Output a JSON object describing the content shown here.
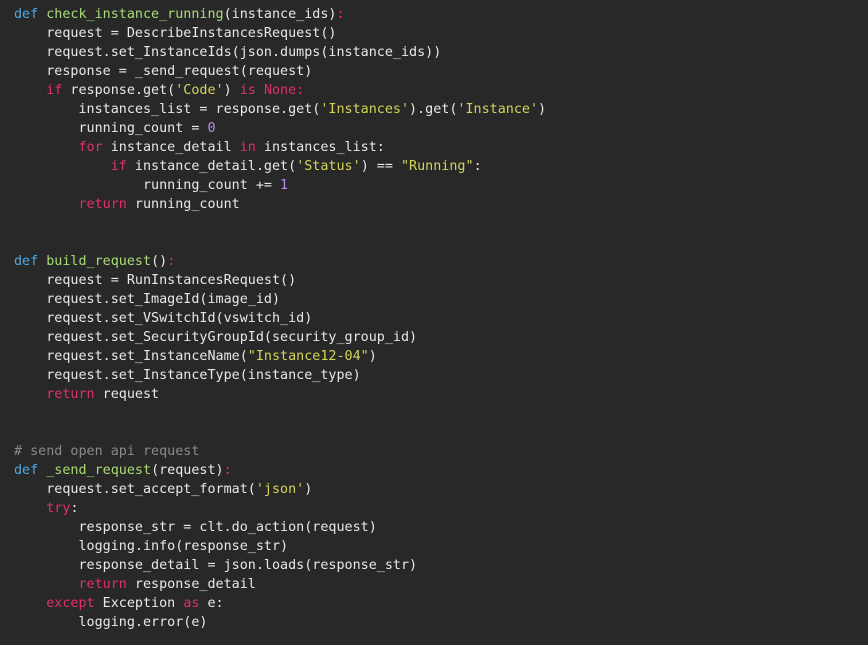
{
  "colors": {
    "background": "#282828",
    "default_text": "#e8e8e8",
    "keyword_def": "#4fa8e0",
    "function_name": "#a9dc76",
    "control_keyword": "#e0306a",
    "string": "#d4d45a",
    "number": "#b48ef0",
    "comment": "#8a8a8a"
  },
  "code": {
    "lines": [
      [
        [
          "kw",
          "def"
        ],
        [
          "txt",
          " "
        ],
        [
          "fn",
          "check_instance_running"
        ],
        [
          "txt",
          "(instance_ids)"
        ],
        [
          "ctrl",
          ":"
        ]
      ],
      [
        [
          "txt",
          "    request = DescribeInstancesRequest()"
        ]
      ],
      [
        [
          "txt",
          "    request.set_InstanceIds(json.dumps(instance_ids))"
        ]
      ],
      [
        [
          "txt",
          "    response = _send_request(request)"
        ]
      ],
      [
        [
          "txt",
          "    "
        ],
        [
          "ctrl",
          "if"
        ],
        [
          "txt",
          " response.get("
        ],
        [
          "str",
          "'Code'"
        ],
        [
          "txt",
          ") "
        ],
        [
          "ctrl",
          "is"
        ],
        [
          "txt",
          " "
        ],
        [
          "ctrl",
          "None"
        ],
        [
          "ctrl",
          ":"
        ]
      ],
      [
        [
          "txt",
          "        instances_list = response.get("
        ],
        [
          "str",
          "'Instances'"
        ],
        [
          "txt",
          ").get("
        ],
        [
          "str",
          "'Instance'"
        ],
        [
          "txt",
          ")"
        ]
      ],
      [
        [
          "txt",
          "        running_count = "
        ],
        [
          "num",
          "0"
        ]
      ],
      [
        [
          "txt",
          "        "
        ],
        [
          "ctrl",
          "for"
        ],
        [
          "txt",
          " instance_detail "
        ],
        [
          "ctrl",
          "in"
        ],
        [
          "txt",
          " instances_list:"
        ]
      ],
      [
        [
          "txt",
          "            "
        ],
        [
          "ctrl",
          "if"
        ],
        [
          "txt",
          " instance_detail.get("
        ],
        [
          "str",
          "'Status'"
        ],
        [
          "txt",
          ") == "
        ],
        [
          "str",
          "\"Running\""
        ],
        [
          "txt",
          ":"
        ]
      ],
      [
        [
          "txt",
          "                running_count += "
        ],
        [
          "num",
          "1"
        ]
      ],
      [
        [
          "txt",
          "        "
        ],
        [
          "ctrl",
          "return"
        ],
        [
          "txt",
          " running_count"
        ]
      ],
      [],
      [],
      [
        [
          "kw",
          "def"
        ],
        [
          "txt",
          " "
        ],
        [
          "fn",
          "build_request"
        ],
        [
          "txt",
          "()"
        ],
        [
          "ctrl",
          ":"
        ]
      ],
      [
        [
          "txt",
          "    request = RunInstancesRequest()"
        ]
      ],
      [
        [
          "txt",
          "    request.set_ImageId(image_id)"
        ]
      ],
      [
        [
          "txt",
          "    request.set_VSwitchId(vswitch_id)"
        ]
      ],
      [
        [
          "txt",
          "    request.set_SecurityGroupId(security_group_id)"
        ]
      ],
      [
        [
          "txt",
          "    request.set_InstanceName("
        ],
        [
          "str",
          "\"Instance12-04\""
        ],
        [
          "txt",
          ")"
        ]
      ],
      [
        [
          "txt",
          "    request.set_InstanceType(instance_type)"
        ]
      ],
      [
        [
          "txt",
          "    "
        ],
        [
          "ctrl",
          "return"
        ],
        [
          "txt",
          " request"
        ]
      ],
      [],
      [],
      [
        [
          "com",
          "# send open api request"
        ]
      ],
      [
        [
          "kw",
          "def"
        ],
        [
          "txt",
          " "
        ],
        [
          "fn",
          "_send_request"
        ],
        [
          "txt",
          "(request)"
        ],
        [
          "ctrl",
          ":"
        ]
      ],
      [
        [
          "txt",
          "    request.set_accept_format("
        ],
        [
          "str",
          "'json'"
        ],
        [
          "txt",
          ")"
        ]
      ],
      [
        [
          "txt",
          "    "
        ],
        [
          "ctrl",
          "try"
        ],
        [
          "txt",
          ":"
        ]
      ],
      [
        [
          "txt",
          "        response_str = clt.do_action(request)"
        ]
      ],
      [
        [
          "txt",
          "        logging.info(response_str)"
        ]
      ],
      [
        [
          "txt",
          "        response_detail = json.loads(response_str)"
        ]
      ],
      [
        [
          "txt",
          "        "
        ],
        [
          "ctrl",
          "return"
        ],
        [
          "txt",
          " response_detail"
        ]
      ],
      [
        [
          "txt",
          "    "
        ],
        [
          "ctrl",
          "except"
        ],
        [
          "txt",
          " Exception "
        ],
        [
          "ctrl",
          "as"
        ],
        [
          "txt",
          " e:"
        ]
      ],
      [
        [
          "txt",
          "        logging.error(e)"
        ]
      ]
    ]
  }
}
